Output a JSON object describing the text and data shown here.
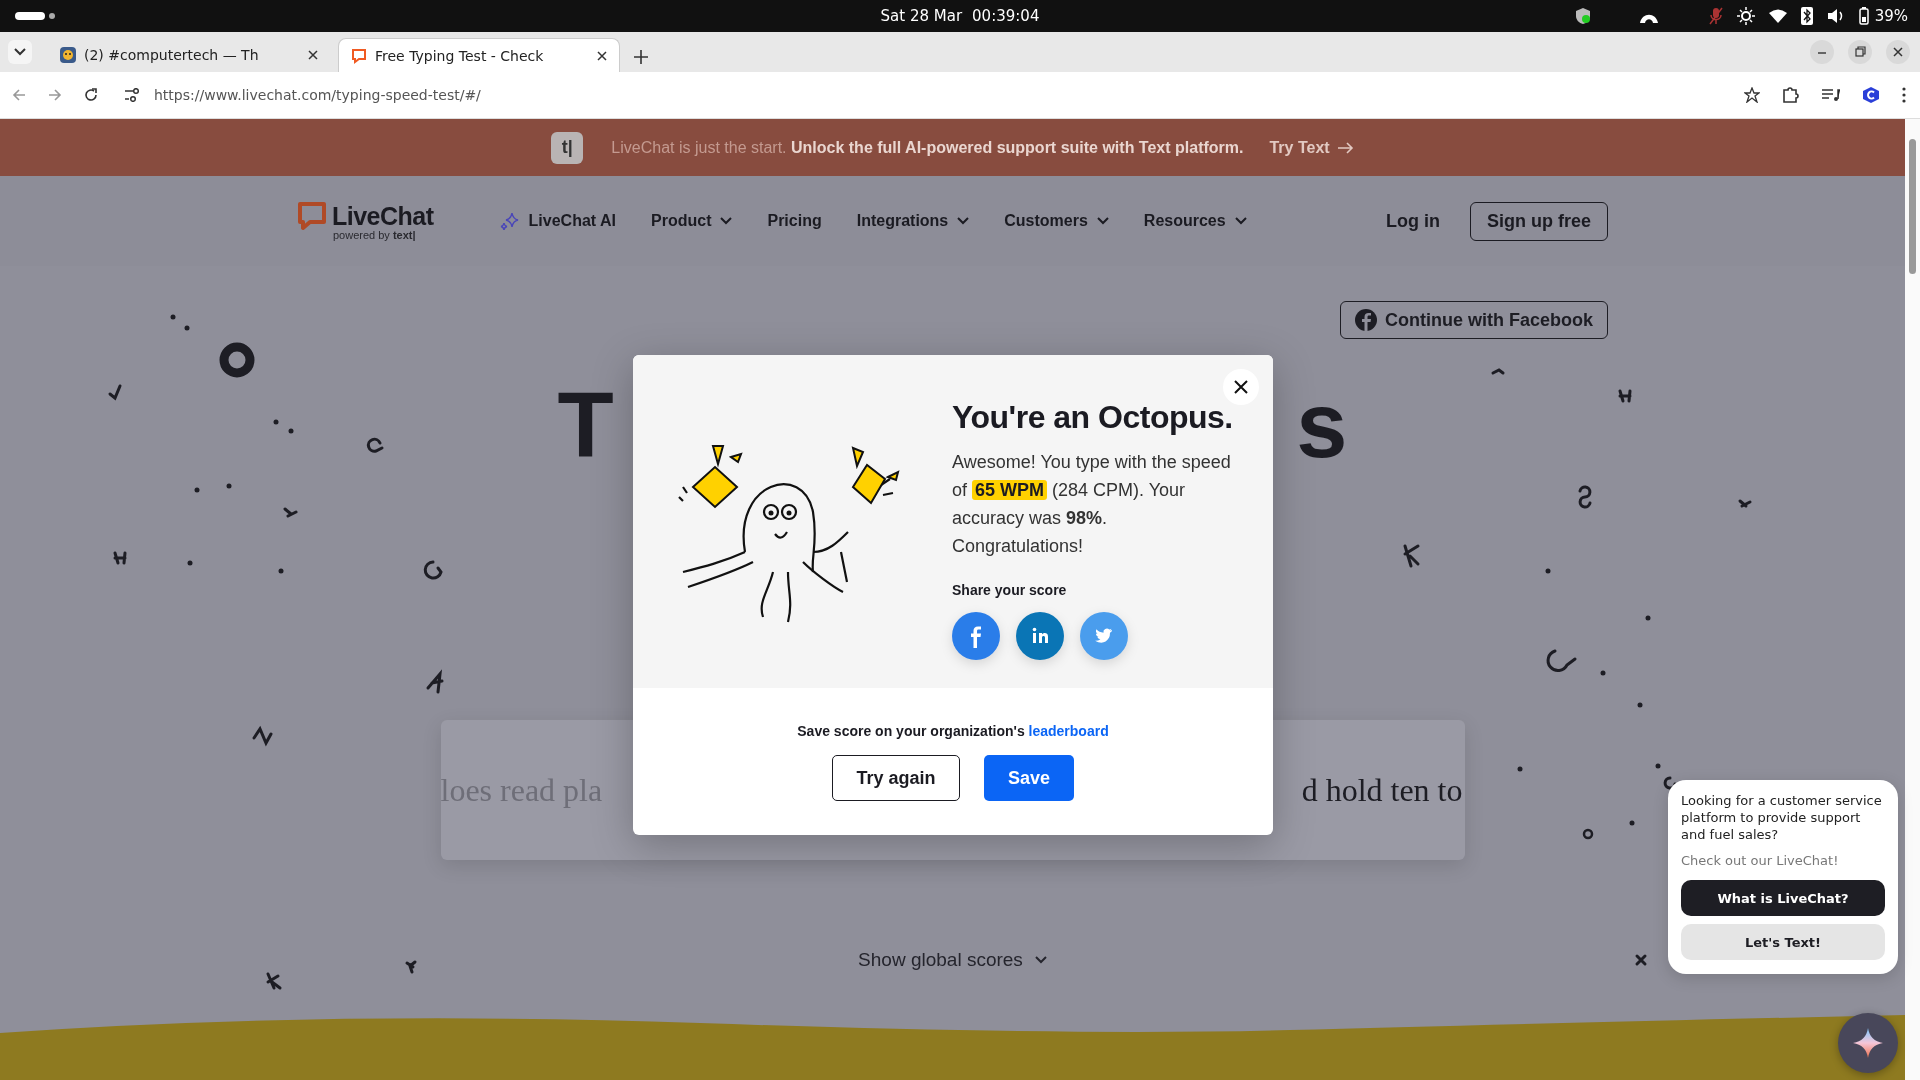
{
  "os_bar": {
    "date": "Sat 28 Mar",
    "time": "00:39:04",
    "battery": "39%"
  },
  "browser": {
    "tabs": [
      {
        "title": "(2) #computertech — Th",
        "selected": false
      },
      {
        "title": "Free Typing Test - Check",
        "selected": true
      }
    ],
    "url": "https://www.livechat.com/typing-speed-test/#/"
  },
  "banner": {
    "logo_text": "t|",
    "text": "LiveChat is just the start. **Unlock the full AI-powered support suite with Text platform.**",
    "link": "Try Text"
  },
  "header": {
    "logo": "LiveChat",
    "tagline": "powered by **text|**",
    "items": [
      {
        "label": "LiveChat AI",
        "kind": "ai"
      },
      {
        "label": "Product",
        "kind": "dropdown"
      },
      {
        "label": "Pricing",
        "kind": "link"
      },
      {
        "label": "Integrations",
        "kind": "dropdown"
      },
      {
        "label": "Customers",
        "kind": "dropdown"
      },
      {
        "label": "Resources",
        "kind": "dropdown"
      }
    ],
    "login": "Log in",
    "signup": "Sign up free"
  },
  "hero": {
    "facebook_button": "Continue with Facebook",
    "heading_fragments": [
      "T",
      "s"
    ],
    "typing": {
      "typed": "loes read pla",
      "upcoming": "d hold ten to"
    },
    "show_scores": "Show global scores"
  },
  "modal": {
    "title": "You're an Octopus.",
    "message": {
      "before": "Awesome! You type with the speed of",
      "highlight": "65 WPM",
      "after": "(284 CPM). Your accuracy was **98%**. Congratulations!"
    },
    "share_label": "Share your score",
    "save_prompt": "Save score on your organization's",
    "save_link": "leaderboard",
    "buttons": [
      {
        "label": "Try again",
        "kind": "secondary"
      },
      {
        "label": "Save",
        "kind": "primary"
      }
    ]
  },
  "chat": {
    "message": "Looking for a customer service platform to provide support and fuel sales?",
    "sub": "Check out our LiveChat!",
    "buttons": [
      {
        "label": "What is LiveChat?",
        "kind": "primary"
      },
      {
        "label": "Let's Text!",
        "kind": "secondary"
      }
    ]
  }
}
